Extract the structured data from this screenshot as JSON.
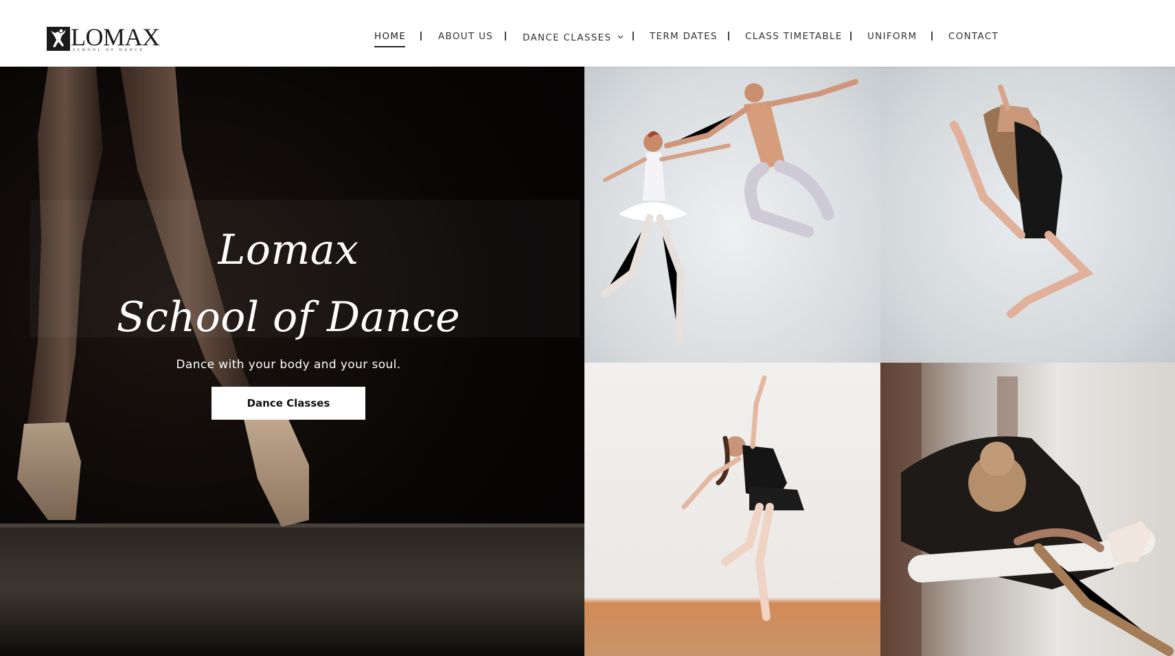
{
  "logo": {
    "wordmark": "LOMAX",
    "tagline": "SCHOOL OF DANCE"
  },
  "nav": {
    "items": [
      {
        "label": "HOME",
        "active": true
      },
      {
        "label": "ABOUT US"
      },
      {
        "label": "DANCE CLASSES",
        "has_dropdown": true
      },
      {
        "label": "TERM DATES"
      },
      {
        "label": "CLASS TIMETABLE"
      },
      {
        "label": "UNIFORM"
      },
      {
        "label": "CONTACT"
      }
    ]
  },
  "hero": {
    "title_line1": "Lomax",
    "title_line2": "School of Dance",
    "subtitle": "Dance with your body and your soul.",
    "button_label": "Dance Classes"
  },
  "colors": {
    "text": "#333333",
    "hero_bg": "#050403",
    "button_bg": "#ffffff"
  }
}
